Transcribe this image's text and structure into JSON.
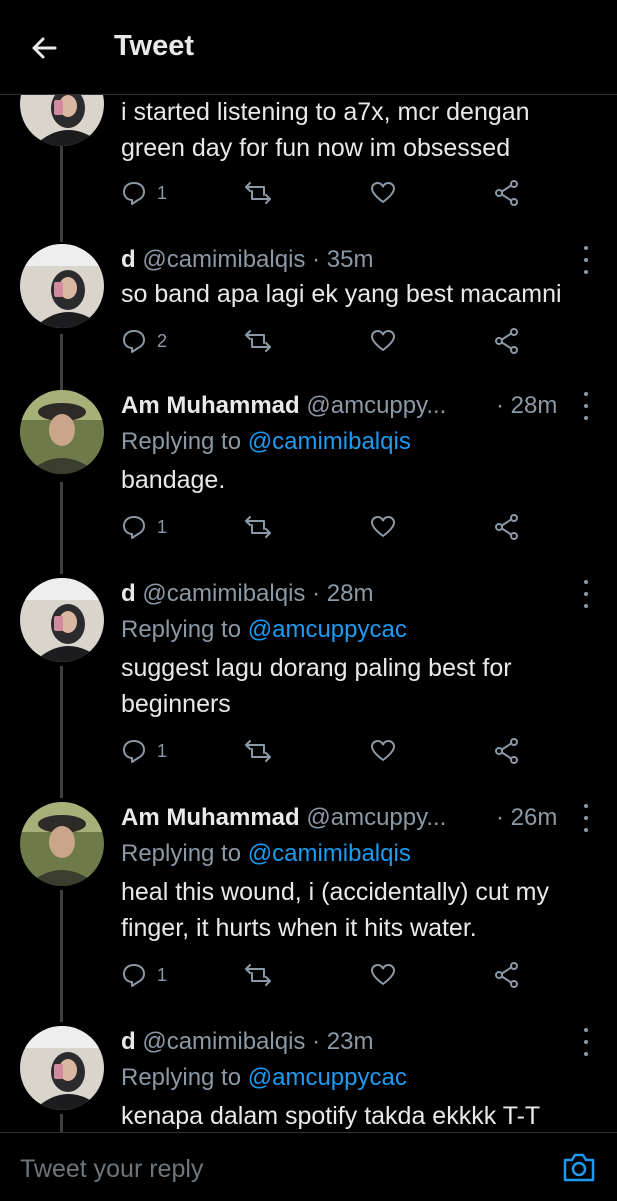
{
  "header": {
    "title": "Tweet"
  },
  "tweets": [
    {
      "name": "",
      "handle": "",
      "time": "",
      "reply_prefix": "",
      "reply_to": "",
      "text": "i started listening to a7x, mcr dengan green day for fun now im obsessed",
      "reply_count": "1"
    },
    {
      "name": "d",
      "handle": "@camimibalqis",
      "time": "· 35m",
      "reply_prefix": "",
      "reply_to": "",
      "text": "so band apa lagi ek yang best macamni",
      "reply_count": "2"
    },
    {
      "name": "Am Muhammad",
      "handle": "@amcuppy...",
      "time": "· 28m",
      "reply_prefix": "Replying to ",
      "reply_to": "@camimibalqis",
      "text": "bandage.",
      "reply_count": "1"
    },
    {
      "name": "d",
      "handle": "@camimibalqis",
      "time": "· 28m",
      "reply_prefix": "Replying to ",
      "reply_to": "@amcuppycac",
      "text": "suggest lagu dorang paling best for beginners",
      "reply_count": "1"
    },
    {
      "name": "Am Muhammad",
      "handle": "@amcuppy...",
      "time": "· 26m",
      "reply_prefix": "Replying to ",
      "reply_to": "@camimibalqis",
      "text": "heal this wound, i (accidentally) cut my finger, it hurts when it hits water.",
      "reply_count": "1"
    },
    {
      "name": "d",
      "handle": "@camimibalqis",
      "time": "· 23m",
      "reply_prefix": "Replying to ",
      "reply_to": "@amcuppycac",
      "text": "kenapa dalam spotify takda ekkkk T-T",
      "reply_count": ""
    }
  ],
  "composer": {
    "placeholder": "Tweet your reply"
  },
  "icons": {
    "back": "arrow-left-icon",
    "reply": "speech-bubble-icon",
    "retweet": "retweet-icon",
    "like": "heart-icon",
    "share": "share-icon",
    "more": "vertical-dots-icon",
    "media": "camera-icon"
  },
  "colors": {
    "background": "#000000",
    "accent": "#1d9bf0",
    "muted": "#8b98a5",
    "text": "#e7e9ea"
  }
}
